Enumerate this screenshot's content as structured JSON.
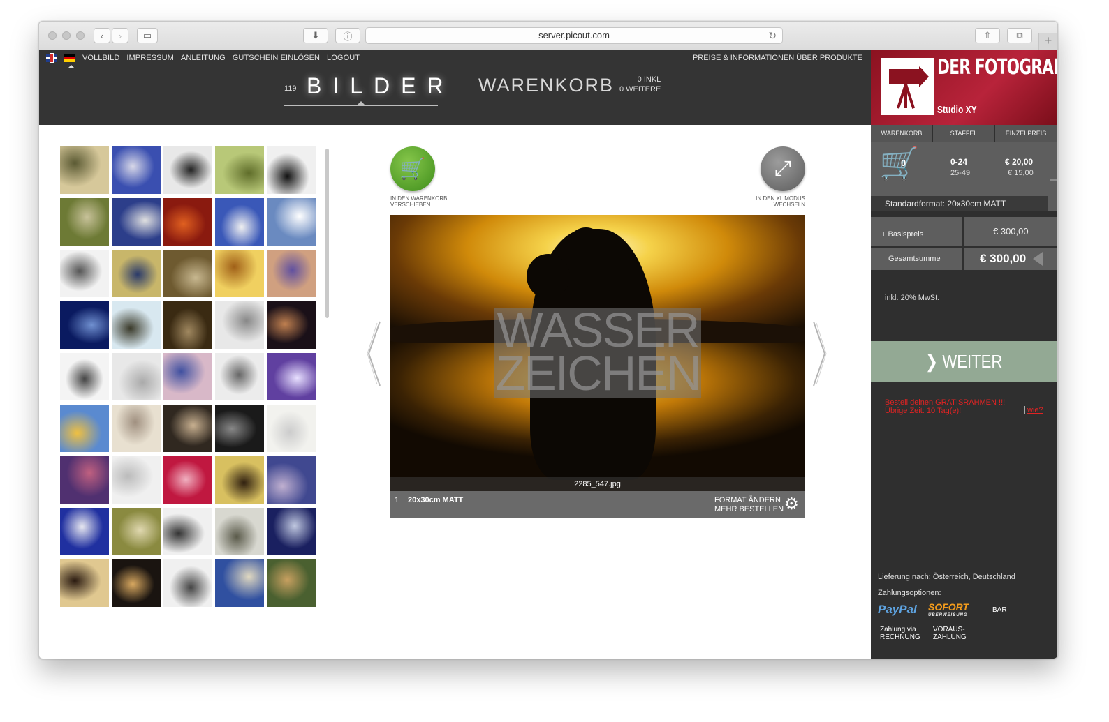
{
  "browser": {
    "url": "server.picout.com"
  },
  "topnav": {
    "items": [
      "VOLLBILD",
      "IMPRESSUM",
      "ANLEITUNG",
      "GUTSCHEIN EINLÖSEN",
      "LOGOUT"
    ],
    "right_link": "PREISE & INFORMATIONEN ÜBER PRODUKTE"
  },
  "tabs": {
    "bilder_count": "119",
    "bilder_label": "BILDER",
    "warenkorb_label": "WARENKORB",
    "warenkorb_count_line1": "0 INKL",
    "warenkorb_count_line2": "0 WEITERE"
  },
  "actions": {
    "add_to_cart_line1": "IN DEN WARENKORB",
    "add_to_cart_line2": "VERSCHIEBEN",
    "xl_mode_line1": "IN DEN XL MODUS",
    "xl_mode_line2": "WECHSELN"
  },
  "photo": {
    "watermark_line1": "WASSER",
    "watermark_line2": "ZEICHEN",
    "filename": "2285_547.jpg",
    "quantity": "1",
    "format": "20x30cm MATT",
    "change_format": "FORMAT ÄNDERN",
    "order_more": "MEHR BESTELLEN"
  },
  "brand": {
    "name": "DER FOTOGRAF",
    "subtitle": "Studio XY"
  },
  "sidebar": {
    "tabs": [
      "WARENKORB",
      "STAFFEL",
      "EINZELPREIS"
    ],
    "cart_count": "0",
    "staffel": [
      {
        "range": "0-24",
        "price": "€ 20,00"
      },
      {
        "range": "25-49",
        "price": "€ 15,00"
      }
    ],
    "standard_format": "Standardformat: 20x30cm MATT",
    "basispreis_label": "+ Basispreis",
    "basispreis_value": "€ 300,00",
    "gesamtsumme_label": "Gesamtsumme",
    "gesamtsumme_value": "€ 300,00",
    "mwst": "inkl. 20% MwSt.",
    "weiter": "WEITER",
    "promo_line1": "Bestell deinen GRATISRAHMEN !!!",
    "promo_line2": "Übrige Zeit: 10 Tag(e)!",
    "promo_link": "wie?",
    "delivery": "Lieferung nach: Österreich, Deutschland",
    "payment_title": "Zahlungsoptionen:",
    "paypal": "PayPal",
    "sofort": "SOFORT",
    "sofort_sub": "ÜBERWEISUNG",
    "bar": "BAR",
    "rechnung_line1": "Zahlung via",
    "rechnung_line2": "RECHNUNG",
    "voraus_line1": "VORAUS-",
    "voraus_line2": "ZAHLUNG"
  }
}
